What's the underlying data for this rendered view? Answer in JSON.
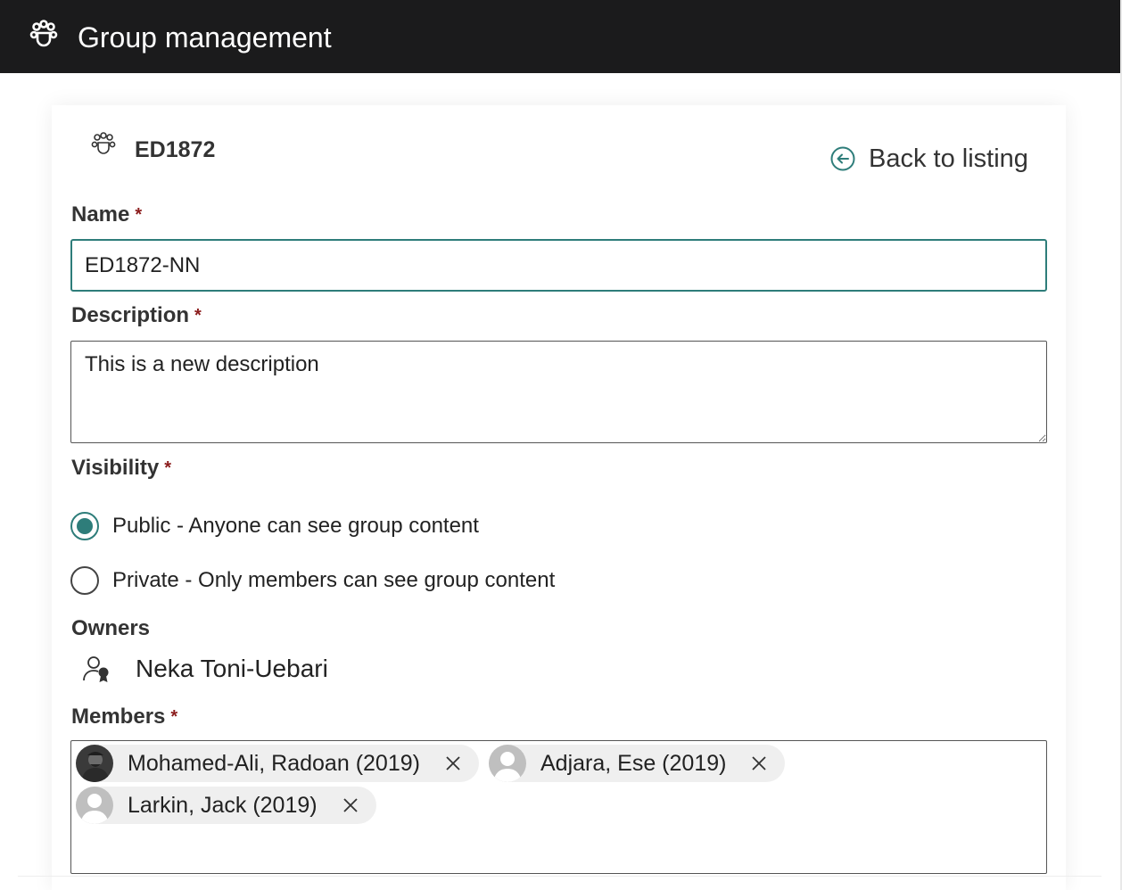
{
  "header": {
    "title": "Group management",
    "logo_icon": "group-icon"
  },
  "group": {
    "code": "ED1872",
    "icon": "group-icon"
  },
  "back_link": {
    "label": "Back to listing",
    "icon": "arrow-left-circle-icon"
  },
  "form": {
    "name": {
      "label": "Name",
      "required_mark": "*",
      "value": "ED1872-NN"
    },
    "description": {
      "label": "Description",
      "required_mark": "*",
      "value": "This is a new description"
    },
    "visibility": {
      "label": "Visibility",
      "required_mark": "*",
      "options": [
        {
          "label": "Public - Anyone can see group content",
          "checked": true
        },
        {
          "label": "Private - Only members can see group content",
          "checked": false
        }
      ]
    },
    "owners": {
      "label": "Owners",
      "items": [
        {
          "name": "Neka Toni-Uebari",
          "icon": "owner-badge-icon"
        }
      ]
    },
    "members": {
      "label": "Members",
      "required_mark": "*",
      "items": [
        {
          "name": "Mohamed-Ali, Radoan (2019)",
          "avatar": "photo"
        },
        {
          "name": "Adjara, Ese (2019)",
          "avatar": "placeholder"
        },
        {
          "name": "Larkin, Jack (2019)",
          "avatar": "placeholder"
        }
      ]
    }
  },
  "colors": {
    "header_bg": "#1b1b1c",
    "accent": "#2e7d7a",
    "required": "#8b1c1c"
  }
}
